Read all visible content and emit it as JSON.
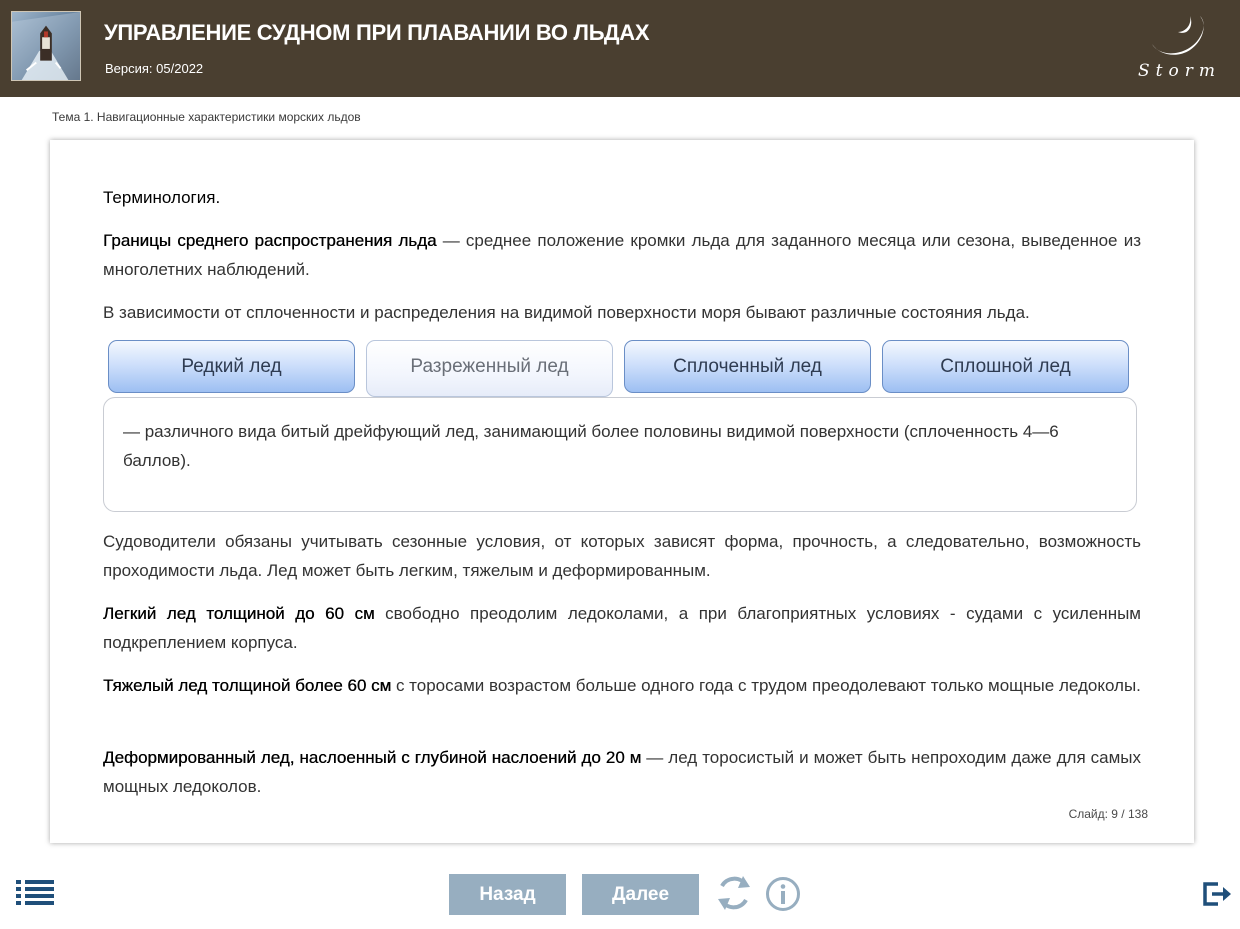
{
  "header": {
    "title": "УПРАВЛЕНИЕ СУДНОМ ПРИ ПЛАВАНИИ ВО ЛЬДАХ",
    "version": "Версия: 05/2022",
    "logo_text": "Storm",
    "thumbnail_icon": "icebreaker-image",
    "background_color": "#4a3f30"
  },
  "breadcrumb": "Тема 1. Навигационные характеристики морских льдов",
  "content": {
    "heading": "Терминология.",
    "p2_bold": "Границы среднего распространения льда",
    "p2_text": " — среднее положение кромки льда для заданного месяца или сезона, выведенное из многолетних наблюдений.",
    "p3_text": "В зависимости от сплоченности и распределения на видимой поверхности моря бывают различные состояния льда.",
    "tabs": [
      {
        "label": "Редкий лед"
      },
      {
        "label": "Разреженный лед"
      },
      {
        "label": "Сплоченный лед"
      },
      {
        "label": "Сплошной лед"
      }
    ],
    "active_tab": "Разреженный лед",
    "tab_panel_text": "— различного вида битый дрейфующий лед, занимающий более половины видимой поверхности (сплоченность 4—6 баллов).",
    "p4_text": "Судоводители обязаны учитывать сезонные условия, от которых зависят форма, прочность, а следовательно, возможность проходимости льда. Лед может быть легким, тяжелым и деформированным.",
    "p5_bold": "Легкий лед толщиной до 60 см",
    "p5_text": " свободно преодолим ледоколами, а при благоприятных условиях - судами с усиленным подкреплением корпуса.",
    "p6_bold": "Тяжелый лед толщиной более 60 см",
    "p6_text": " с торосами возрастом больше одного года с трудом преодолевают только мощные ледоколы.",
    "p7_bold": "Деформированный лед, наслоенный с глубиной наслоений до 20 м",
    "p7_text": " — лед торосистый и может быть непроходим даже для самых мощных ледоколов."
  },
  "slide_counter": "Слайд: 9 / 138",
  "footer": {
    "menu_icon": "list-menu-icon",
    "back_label": "Назад",
    "next_label": "Далее",
    "refresh_icon": "refresh-icon",
    "info_icon": "info-icon",
    "exit_icon": "exit-icon",
    "button_color": "#97aec0",
    "icon_color": "#1f4f7a"
  }
}
